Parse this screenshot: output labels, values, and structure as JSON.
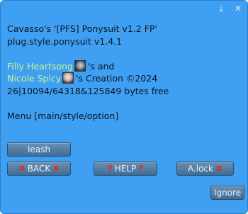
{
  "titlebar": {
    "icons": [
      "dock-icon",
      "close-icon"
    ],
    "glyphs": {
      "dock": "⤓",
      "close": "✕"
    }
  },
  "message": {
    "line1": "Cavasso's '[PFS] Ponysuit v1.2 FP'",
    "line2": "plug.style.ponysuit v1.4.1",
    "creator1": "Filly Heartsong",
    "and_text": "'s and",
    "creator2": "Nicole Spicy",
    "creation_text": "'s Creation ©2024",
    "memory": "26|10094/64318&125849 bytes free",
    "menu": "Menu [main/style/option]"
  },
  "buttons": {
    "leash": "leash",
    "back": "BACK",
    "help": "HELP",
    "alock": "A.lock",
    "ignore": "Ignore"
  },
  "glyphs": {
    "x": "✖",
    "q": "?"
  },
  "colors": {
    "panel": "#3f9ff2",
    "creator_name": "#c8f68a",
    "button": "#3f6d98",
    "mark": "#d9302d"
  }
}
